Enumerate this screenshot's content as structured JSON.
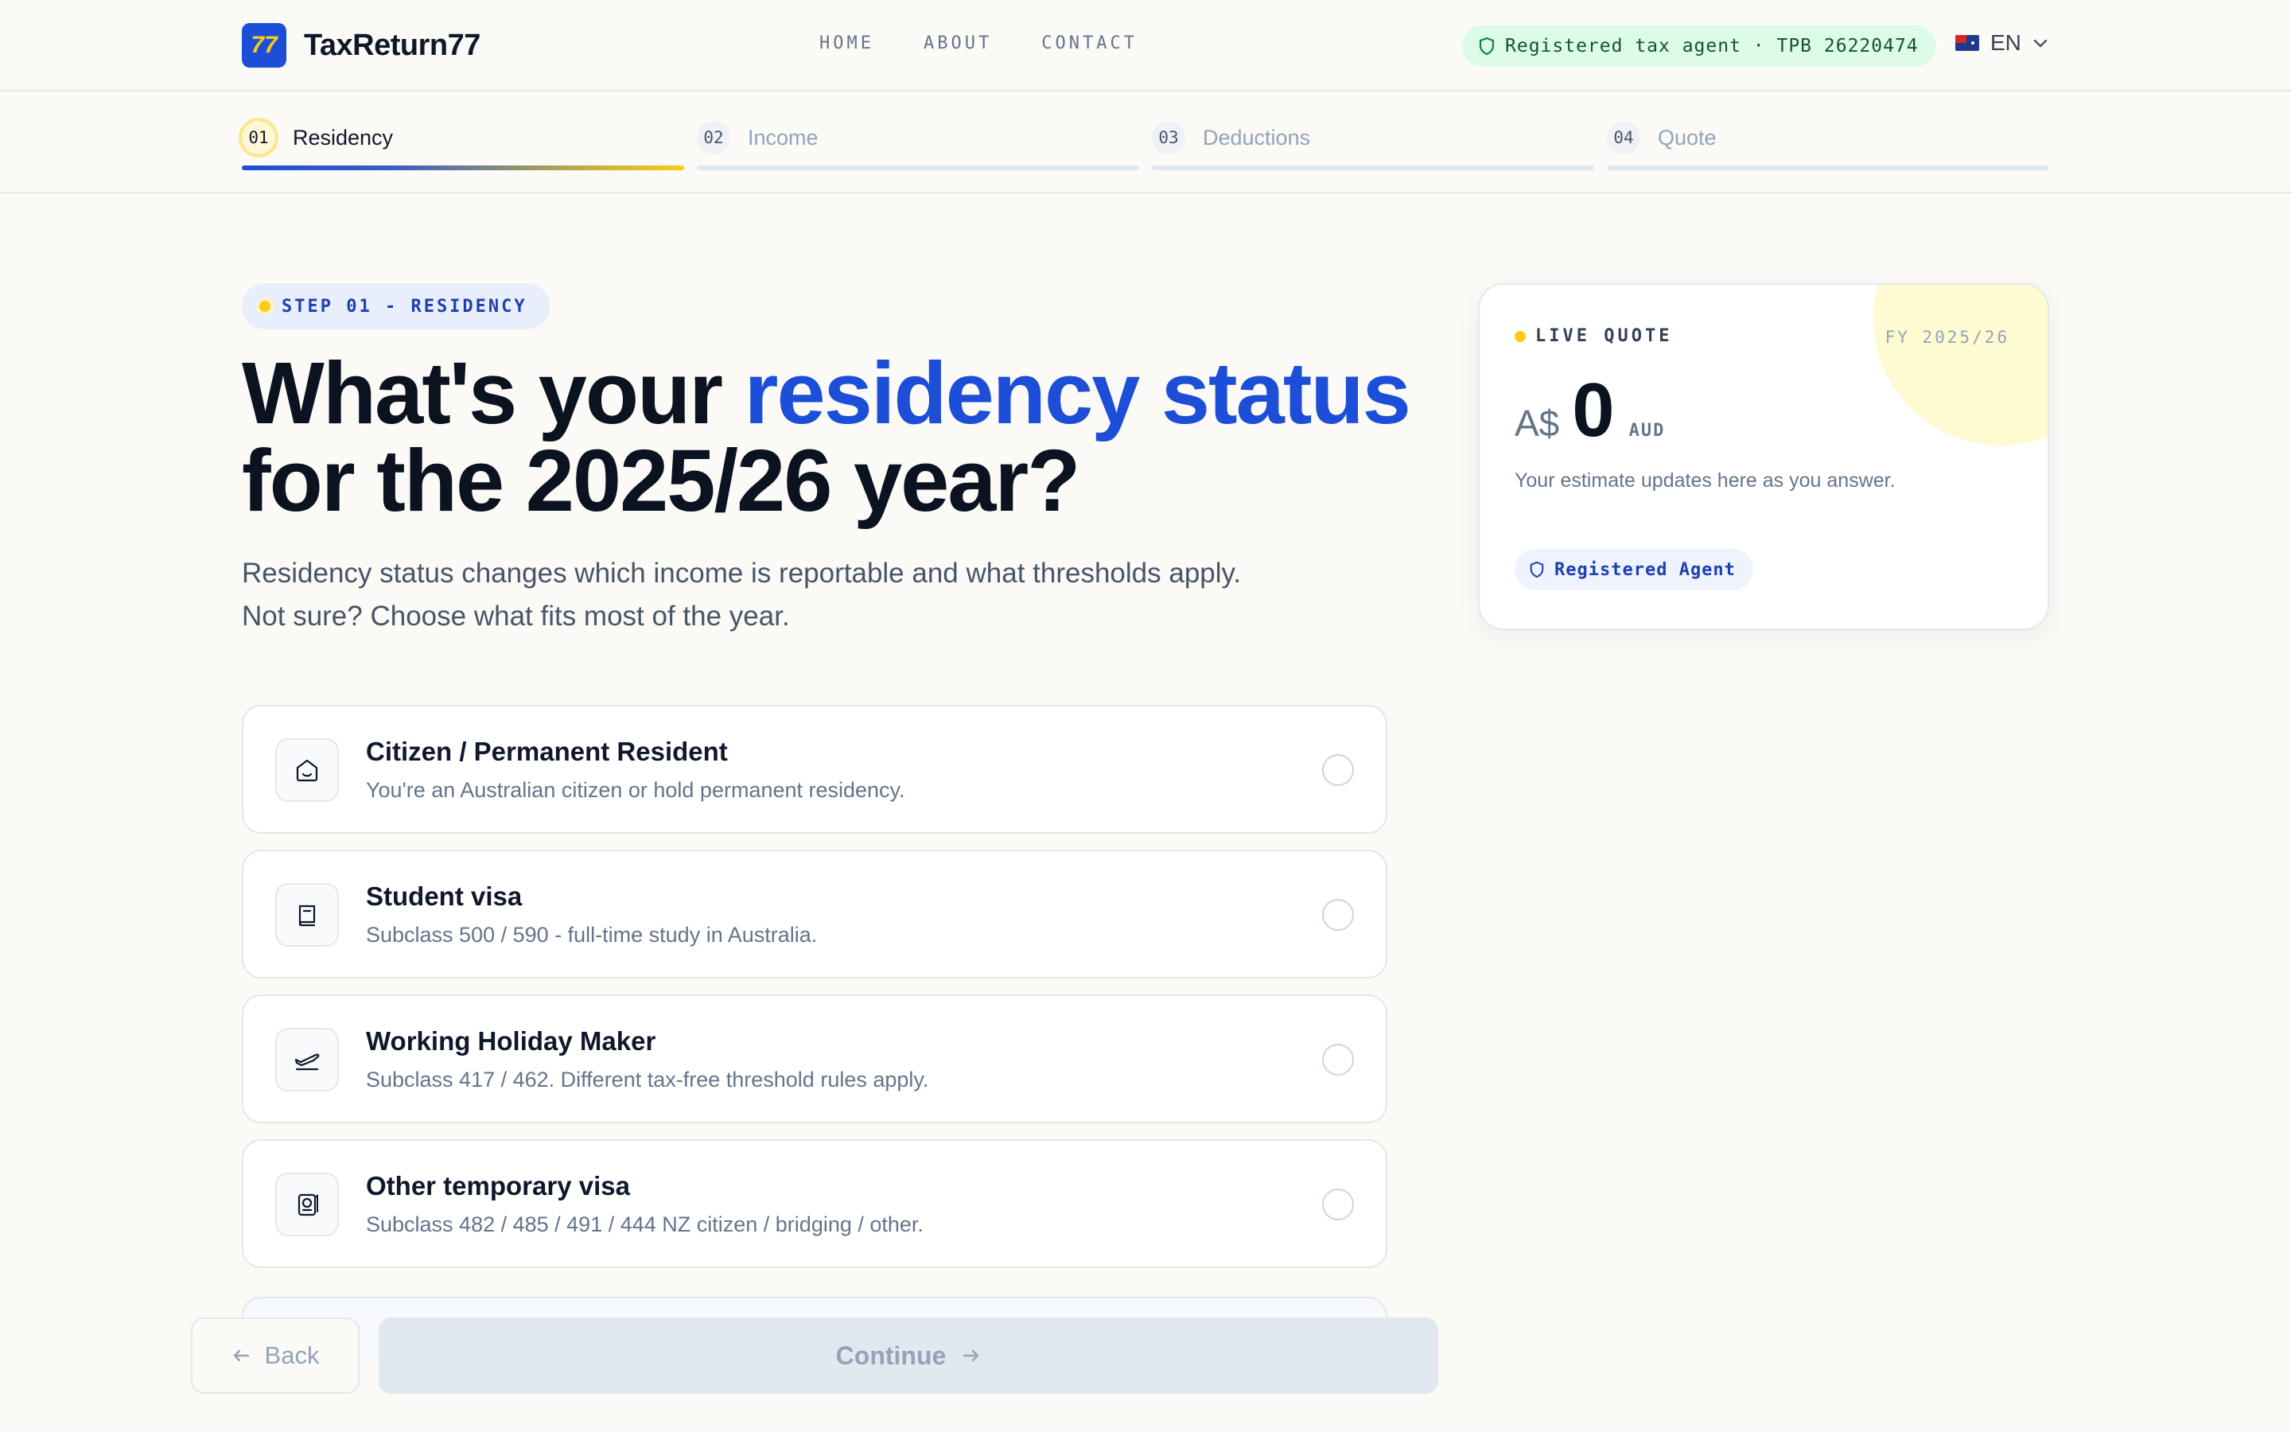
{
  "brand": {
    "logo_text": "77",
    "name": "TaxReturn77"
  },
  "nav": [
    "HOME",
    "ABOUT",
    "CONTACT"
  ],
  "agent_badge": "Registered tax agent · TPB 26220474",
  "language": {
    "selected": "EN"
  },
  "steps": [
    {
      "num": "01",
      "label": "Residency"
    },
    {
      "num": "02",
      "label": "Income"
    },
    {
      "num": "03",
      "label": "Deductions"
    },
    {
      "num": "04",
      "label": "Quote"
    }
  ],
  "active_step": "01",
  "tag": "STEP 01 - RESIDENCY",
  "heading": {
    "prefix": "What's your ",
    "accent": "residency status",
    "suffix": "for the 2025/26 year?"
  },
  "subtitle": "Residency status changes which income is reportable and what thresholds apply. Not sure? Choose what fits most of the year.",
  "options": [
    {
      "title": "Citizen / Permanent Resident",
      "desc": "You're an Australian citizen or hold permanent residency.",
      "icon": "home-icon",
      "selected": false
    },
    {
      "title": "Student visa",
      "desc": "Subclass 500 / 590 - full-time study in Australia.",
      "icon": "book-icon",
      "selected": false
    },
    {
      "title": "Working Holiday Maker",
      "desc": "Subclass 417 / 462. Different tax-free threshold rules apply.",
      "icon": "plane-icon",
      "selected": false
    },
    {
      "title": "Other temporary visa",
      "desc": "Subclass 482 / 485 / 491 / 444 NZ citizen / bridging / other.",
      "icon": "passport-icon",
      "selected": false
    }
  ],
  "buttons": {
    "back": "Back",
    "continue": "Continue"
  },
  "quote": {
    "live_label": "LIVE QUOTE",
    "fy": "FY 2025/26",
    "currency": "A$",
    "value": "0",
    "unit": "AUD",
    "hint": "Your estimate updates here as you answer.",
    "badge": "Registered Agent"
  },
  "colors": {
    "accent": "#1d4ed8",
    "highlight": "#facc15",
    "agent_green": "#dcfce7"
  }
}
